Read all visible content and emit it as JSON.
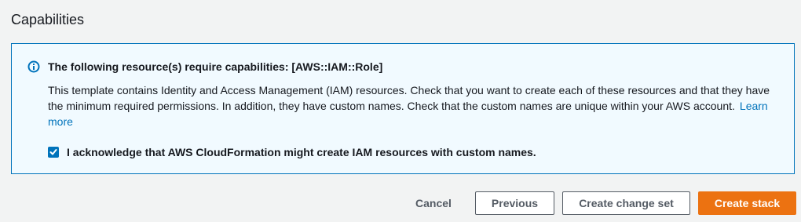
{
  "section": {
    "title": "Capabilities"
  },
  "info": {
    "icon": "info-icon",
    "heading": "The following resource(s) require capabilities: [AWS::IAM::Role]",
    "body": "This template contains Identity and Access Management (IAM) resources. Check that you want to create each of these resources and that they have the minimum required permissions. In addition, they have custom names. Check that the custom names are unique within your AWS account.",
    "learn_more": "Learn more",
    "accent_color": "#0073bb"
  },
  "acknowledge": {
    "checked": true,
    "label": "I acknowledge that AWS CloudFormation might create IAM resources with custom names."
  },
  "actions": {
    "cancel": "Cancel",
    "previous": "Previous",
    "create_change_set": "Create change set",
    "create_stack": "Create stack",
    "primary_color": "#ec7211"
  }
}
